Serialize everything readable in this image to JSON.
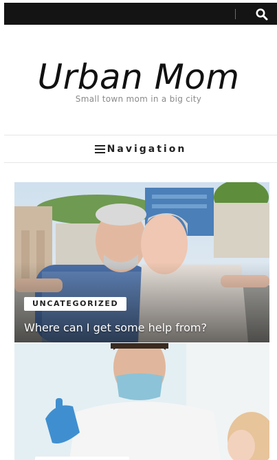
{
  "site": {
    "title": "Urban Mom",
    "tagline": "Small town mom in a big city"
  },
  "nav": {
    "label": "Navigation",
    "menu_icon": "hamburger-icon"
  },
  "topbar": {
    "search_icon": "search-icon"
  },
  "posts": [
    {
      "category": "UNCATEGORIZED",
      "title": "Where can I get some help from?"
    }
  ]
}
